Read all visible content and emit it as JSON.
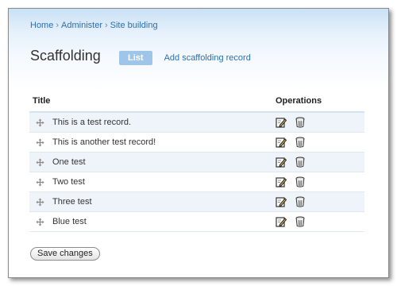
{
  "breadcrumb": [
    {
      "label": "Home"
    },
    {
      "label": "Administer"
    },
    {
      "label": "Site building"
    }
  ],
  "breadcrumb_separator": "›",
  "page": {
    "title": "Scaffolding"
  },
  "tabs": {
    "active": "List",
    "secondary": "Add scaffolding record"
  },
  "table": {
    "columns": [
      "Title",
      "Operations"
    ],
    "rows": [
      {
        "title": "This is a test record."
      },
      {
        "title": "This is another test record!"
      },
      {
        "title": "One test"
      },
      {
        "title": "Two test"
      },
      {
        "title": "Three test"
      },
      {
        "title": "Blue test"
      }
    ]
  },
  "icons": {
    "drag": "drag-handle-icon",
    "edit": "edit-icon",
    "delete": "trash-icon"
  },
  "form": {
    "save_label": "Save changes"
  },
  "colors": {
    "link": "#2a6fb0",
    "active_tab": "#9fc6e8",
    "row_stripe": "#eef4fa"
  }
}
